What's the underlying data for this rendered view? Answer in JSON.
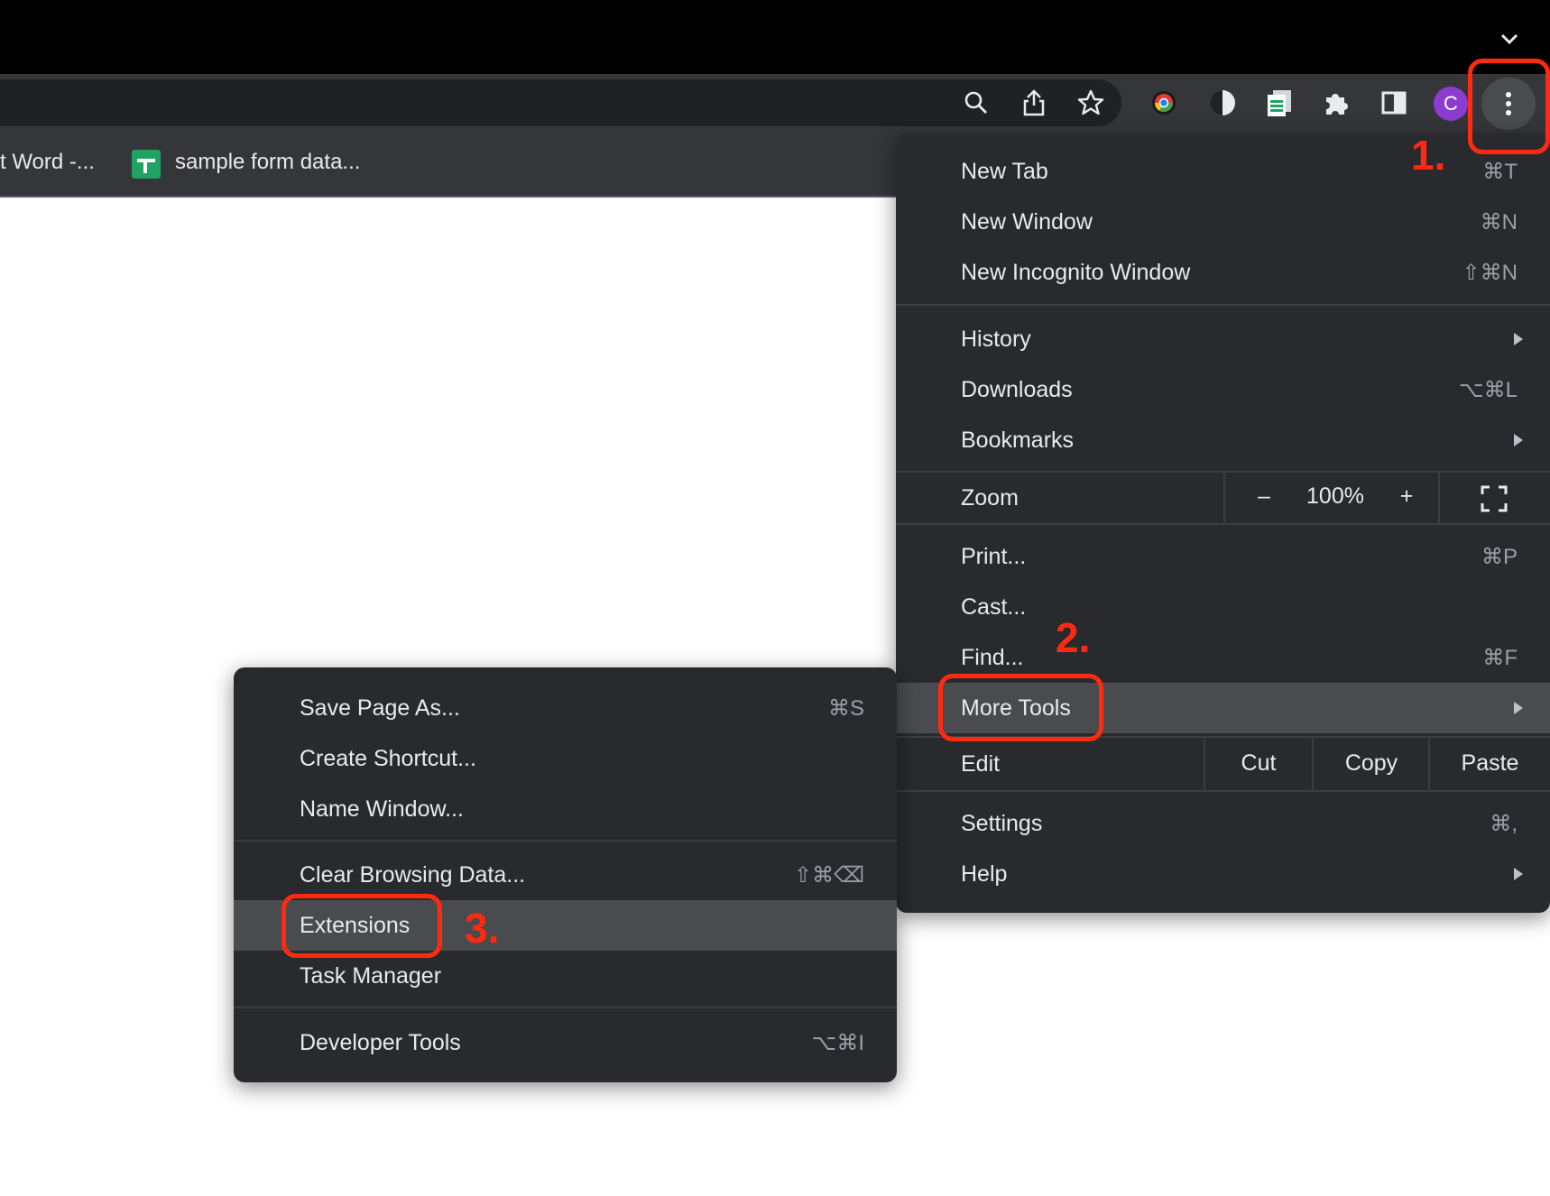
{
  "bookmarks": {
    "item1": "t Word -...",
    "item2": "sample form data..."
  },
  "profile": {
    "initial": "C",
    "color": "#8e3bd1"
  },
  "toolbar_icons": [
    "search-icon",
    "share-icon",
    "star-icon",
    "chrome-color-icon",
    "dark-mode-icon",
    "sheets-extension-icon",
    "extensions-puzzle-icon",
    "side-panel-icon",
    "kebab-menu-icon"
  ],
  "main_menu": {
    "new_tab": {
      "label": "New Tab",
      "shortcut": "⌘T"
    },
    "new_window": {
      "label": "New Window",
      "shortcut": "⌘N"
    },
    "new_incognito": {
      "label": "New Incognito Window",
      "shortcut": "⇧⌘N"
    },
    "history": {
      "label": "History"
    },
    "downloads": {
      "label": "Downloads",
      "shortcut": "⌥⌘L"
    },
    "bookmarks": {
      "label": "Bookmarks"
    },
    "zoom": {
      "label": "Zoom",
      "minus": "–",
      "value": "100%",
      "plus": "+"
    },
    "print": {
      "label": "Print...",
      "shortcut": "⌘P"
    },
    "cast": {
      "label": "Cast..."
    },
    "find": {
      "label": "Find...",
      "shortcut": "⌘F"
    },
    "more_tools": {
      "label": "More Tools"
    },
    "edit": {
      "label": "Edit",
      "cut": "Cut",
      "copy": "Copy",
      "paste": "Paste"
    },
    "settings": {
      "label": "Settings",
      "shortcut": "⌘,"
    },
    "help": {
      "label": "Help"
    }
  },
  "sub_menu": {
    "save_page": {
      "label": "Save Page As...",
      "shortcut": "⌘S"
    },
    "create_shortcut": {
      "label": "Create Shortcut..."
    },
    "name_window": {
      "label": "Name Window..."
    },
    "clear_browsing": {
      "label": "Clear Browsing Data...",
      "shortcut": "⇧⌘⌫"
    },
    "extensions": {
      "label": "Extensions"
    },
    "task_manager": {
      "label": "Task Manager"
    },
    "developer_tools": {
      "label": "Developer Tools",
      "shortcut": "⌥⌘I"
    }
  },
  "annotations": {
    "step1": "1.",
    "step2": "2.",
    "step3": "3.",
    "color": "#ff2a10"
  }
}
